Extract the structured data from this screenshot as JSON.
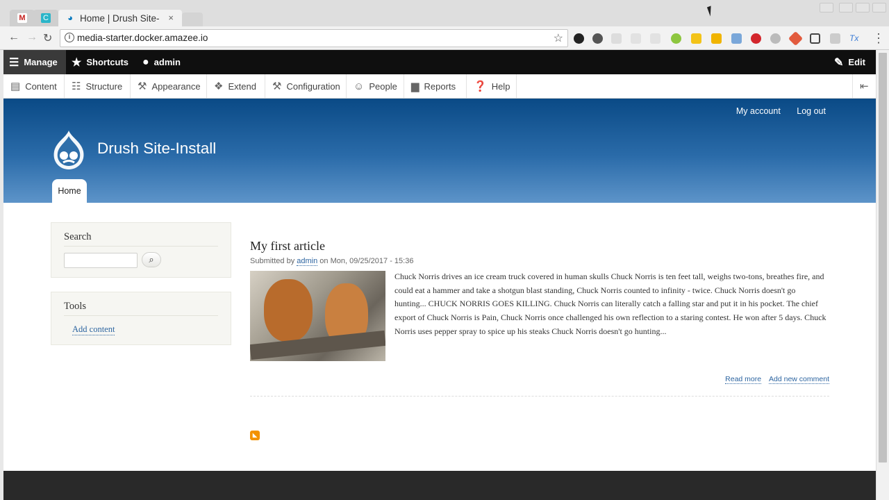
{
  "browser": {
    "pinned_tabs": [
      {
        "icon": "gmail-icon",
        "glyph": "M"
      },
      {
        "icon": "app-icon",
        "glyph": "C"
      }
    ],
    "active_tab": {
      "title": "Home | Drush Site-",
      "close": "×"
    },
    "url": "media-starter.docker.amazee.io"
  },
  "drupal_toolbar": {
    "manage": "Manage",
    "shortcuts": "Shortcuts",
    "user": "admin",
    "edit": "Edit"
  },
  "admin_menu": [
    {
      "label": "Content",
      "icon": "content-icon"
    },
    {
      "label": "Structure",
      "icon": "structure-icon"
    },
    {
      "label": "Appearance",
      "icon": "appearance-icon"
    },
    {
      "label": "Extend",
      "icon": "extend-icon"
    },
    {
      "label": "Configuration",
      "icon": "configuration-icon"
    },
    {
      "label": "People",
      "icon": "people-icon"
    },
    {
      "label": "Reports",
      "icon": "reports-icon"
    },
    {
      "label": "Help",
      "icon": "help-icon"
    }
  ],
  "header": {
    "my_account": "My account",
    "log_out": "Log out",
    "site_name": "Drush Site-Install",
    "home_tab": "Home"
  },
  "sidebar": {
    "search_title": "Search",
    "tools_title": "Tools",
    "add_content": "Add content"
  },
  "article": {
    "title": "My first article",
    "submitted_prefix": "Submitted by",
    "author": "admin",
    "submitted_suffix": "on Mon, 09/25/2017 - 15:36",
    "body": "Chuck Norris drives an ice cream truck covered in human skulls Chuck Norris is ten feet tall, weighs two-tons, breathes fire, and could eat a hammer and take a shotgun blast standing, Chuck Norris counted to infinity - twice. Chuck Norris doesn't go hunting... CHUCK NORRIS GOES KILLING. Chuck Norris can literally catch a falling star and put it in his pocket. The chief export of Chuck Norris is Pain, Chuck Norris once challenged his own reflection to a staring contest. He won after 5 days. Chuck Norris uses pepper spray to spice up his steaks Chuck Norris doesn't go hunting...",
    "read_more": "Read more",
    "add_comment": "Add new comment"
  },
  "colors": {
    "header_top": "#0a4a86",
    "header_bottom": "#5d94c9",
    "link": "#2c64a0",
    "rss": "#f39200"
  }
}
